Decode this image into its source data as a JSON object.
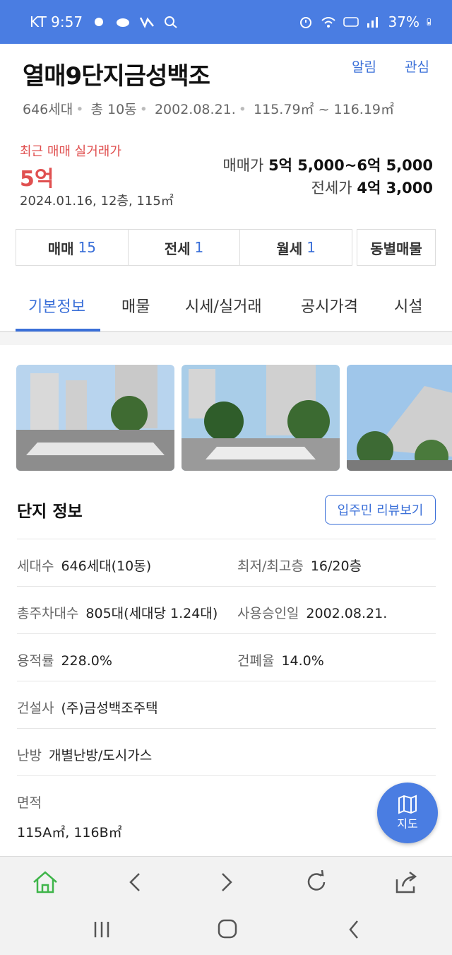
{
  "status_bar": {
    "carrier_time": "KT 9:57",
    "battery": "37%",
    "icons": [
      "notification-icon",
      "cloud-icon",
      "network-icon",
      "search-icon",
      "alarm-icon",
      "wifi-icon",
      "hd-icon",
      "signal-icon",
      "battery-icon"
    ]
  },
  "header": {
    "title": "열매9단지금성백조",
    "links": {
      "alarm": "알림",
      "favorite": "관심"
    },
    "meta": {
      "households": "646세대",
      "buildings": "총 10동",
      "approval": "2002.08.21.",
      "area_range": "115.79㎡ ~ 116.19㎡"
    }
  },
  "price": {
    "recent_label": "최근 매매 실거래가",
    "recent_value": "5억",
    "recent_detail": "2024.01.16, 12층, 115㎡",
    "sale_label": "매매가",
    "sale_value": "5억 5,000~6억 5,000",
    "jeonse_label": "전세가",
    "jeonse_value": "4억 3,000"
  },
  "deal_tabs": [
    {
      "label": "매매",
      "count": "15"
    },
    {
      "label": "전세",
      "count": "1"
    },
    {
      "label": "월세",
      "count": "1"
    }
  ],
  "dongbyeol_label": "동별매물",
  "nav_tabs": [
    "기본정보",
    "매물",
    "시세/실거래",
    "공시가격",
    "시설"
  ],
  "complex_info": {
    "title": "단지 정보",
    "review_button": "입주민 리뷰보기",
    "rows": {
      "households_k": "세대수",
      "households_v": "646세대(10동)",
      "floors_k": "최저/최고층",
      "floors_v": "16/20층",
      "parking_k": "총주차대수",
      "parking_v": "805대(세대당 1.24대)",
      "approval_k": "사용승인일",
      "approval_v": "2002.08.21.",
      "far_k": "용적률",
      "far_v": "228.0%",
      "bcr_k": "건폐율",
      "bcr_v": "14.0%",
      "builder_k": "건설사",
      "builder_v": "(주)금성백조주택",
      "heating_k": "난방",
      "heating_v": "개별난방/도시가스",
      "area_k": "면적",
      "area_v": "115A㎡, 116B㎡"
    }
  },
  "map_button": "지도",
  "colors": {
    "accent": "#3a6fd8",
    "status_bar": "#4a7de2",
    "price_red": "#e05050"
  }
}
